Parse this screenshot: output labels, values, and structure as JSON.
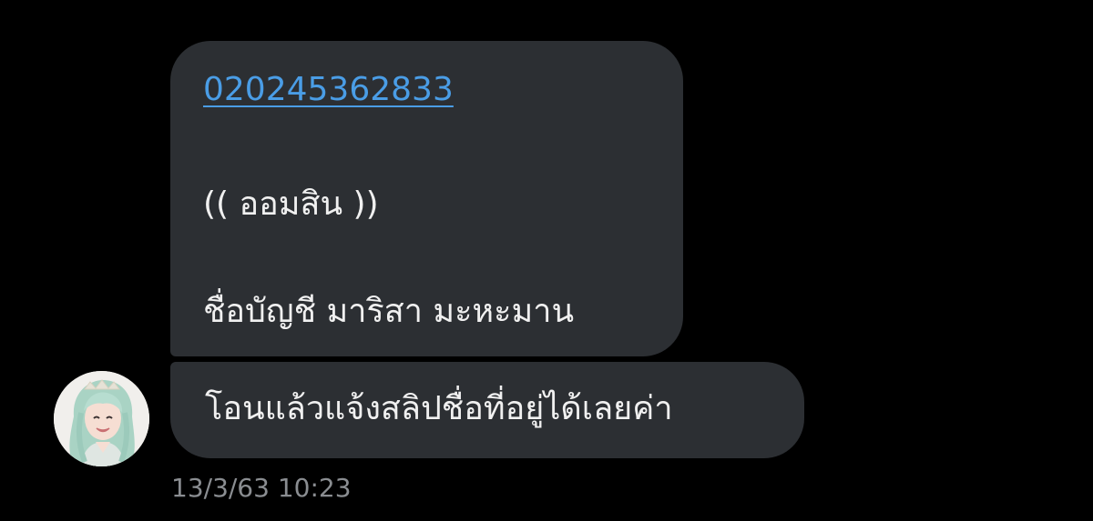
{
  "messages": [
    {
      "lines": {
        "account_number": "020245362833",
        "bank_note": "(( ออมสิน ))",
        "account_name": "ชื่อบัญชี  มาริสา มะหะมาน"
      }
    },
    {
      "text": "โอนแล้วแจ้งสลิปชื่อที่อยู่ได้เลยค่า"
    }
  ],
  "timestamp": "13/3/63 10:23",
  "avatar": {
    "icon": "user-avatar-photo"
  },
  "colors": {
    "background": "#000000",
    "bubble": "#2c2f33",
    "text": "#f0f0f0",
    "link": "#4a9de6",
    "timestamp": "#8a8d91"
  }
}
